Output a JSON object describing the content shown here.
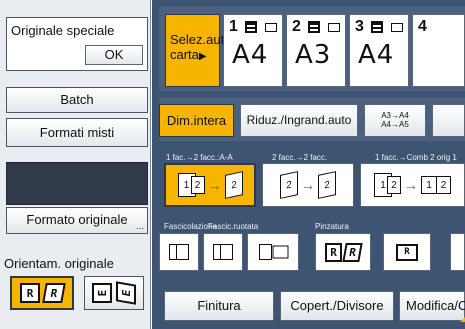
{
  "left_panel": {
    "original_speciale": {
      "title": "Originale speciale",
      "ok_label": "OK"
    },
    "batch_label": "Batch",
    "formati_misti_label": "Formati misti",
    "formato_originale_label": "Formato originale",
    "formato_originale_more": "...",
    "orientation_label": "Orientam. originale",
    "orientation_options": [
      {
        "glyphs": [
          "R",
          "R"
        ],
        "selected": true
      },
      {
        "glyphs": [
          "E",
          "E"
        ],
        "selected": false
      }
    ]
  },
  "paper": {
    "auto_label_line1": "Selez.auto",
    "auto_label_line2": "carta",
    "auto_arrow": "▶",
    "trays": [
      {
        "num": "1",
        "size": "A4"
      },
      {
        "num": "2",
        "size": "A3"
      },
      {
        "num": "3",
        "size": "A4"
      },
      {
        "num": "4",
        "size": ""
      }
    ]
  },
  "reduce": {
    "dim_intera": "Dim.intera",
    "riduz_auto": "Riduz./Ingrand.auto",
    "a3_a4_line1": "A3→A4",
    "a3_a4_line2": "A4→A5"
  },
  "duplex": {
    "label_1": "1 fac.→2 facc.:A-A",
    "label_2": "2 facc.→2 facc.",
    "label_3": "1 facc.→Comb 2 orig 1",
    "btn1_pages": [
      "1",
      "2",
      "2"
    ],
    "btn2_pages": [
      "2",
      "2"
    ],
    "btn3_pages": [
      "1",
      "2",
      "1",
      "2"
    ]
  },
  "finishing": {
    "label_fascicolazione": "Fascicolazione",
    "label_ruotata": "Fascic.ruotata",
    "label_pinzatura": "Pinzatura",
    "staple_glyphs": [
      "R",
      "R"
    ],
    "staple_glyph_2": "R"
  },
  "tabs": {
    "finitura": "Finitura",
    "copert": "Copert./Divisore",
    "modifica": "Modifica/C"
  },
  "colors": {
    "selected": "#f7b500",
    "panel_dark": "#3d5572",
    "left_bg": "#e9edf1"
  }
}
